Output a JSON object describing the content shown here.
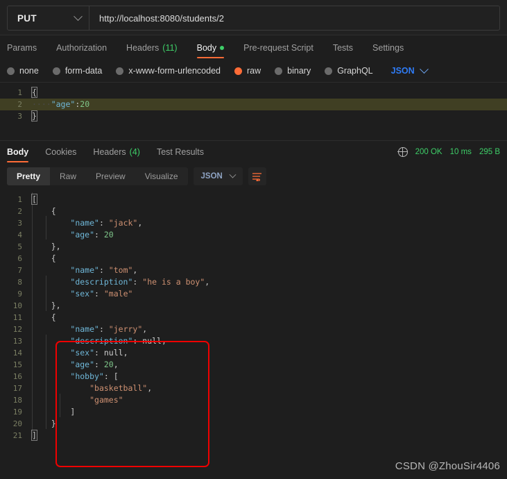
{
  "request": {
    "method": "PUT",
    "url": "http://localhost:8080/students/2",
    "tabs": [
      {
        "label": "Params",
        "count": "",
        "active": false,
        "dot": false
      },
      {
        "label": "Authorization",
        "count": "",
        "active": false,
        "dot": false
      },
      {
        "label": "Headers",
        "count": "(11)",
        "active": false,
        "dot": false
      },
      {
        "label": "Body",
        "count": "",
        "active": true,
        "dot": true
      },
      {
        "label": "Pre-request Script",
        "count": "",
        "active": false,
        "dot": false
      },
      {
        "label": "Tests",
        "count": "",
        "active": false,
        "dot": false
      },
      {
        "label": "Settings",
        "count": "",
        "active": false,
        "dot": false
      }
    ],
    "body_types": [
      {
        "label": "none",
        "selected": false
      },
      {
        "label": "form-data",
        "selected": false
      },
      {
        "label": "x-www-form-urlencoded",
        "selected": false
      },
      {
        "label": "raw",
        "selected": true
      },
      {
        "label": "binary",
        "selected": false
      },
      {
        "label": "GraphQL",
        "selected": false
      }
    ],
    "format": "JSON",
    "body_lines": [
      {
        "num": "1",
        "text": "{",
        "highlight": false
      },
      {
        "num": "2",
        "text": "    \"age\":20",
        "highlight": true
      },
      {
        "num": "3",
        "text": "}",
        "highlight": false
      }
    ]
  },
  "response": {
    "tabs": [
      {
        "label": "Body",
        "count": "",
        "active": true
      },
      {
        "label": "Cookies",
        "count": "",
        "active": false
      },
      {
        "label": "Headers",
        "count": "(4)",
        "active": false
      },
      {
        "label": "Test Results",
        "count": "",
        "active": false
      }
    ],
    "status": "200 OK",
    "time": "10 ms",
    "size": "295 B",
    "views": [
      {
        "label": "Pretty",
        "active": true
      },
      {
        "label": "Raw",
        "active": false
      },
      {
        "label": "Preview",
        "active": false
      },
      {
        "label": "Visualize",
        "active": false
      }
    ],
    "format": "JSON",
    "body_lines": [
      {
        "num": "1",
        "text": "["
      },
      {
        "num": "2",
        "text": "    {"
      },
      {
        "num": "3",
        "text": "        \"name\": \"jack\","
      },
      {
        "num": "4",
        "text": "        \"age\": 20"
      },
      {
        "num": "5",
        "text": "    },"
      },
      {
        "num": "6",
        "text": "    {"
      },
      {
        "num": "7",
        "text": "        \"name\": \"tom\","
      },
      {
        "num": "8",
        "text": "        \"description\": \"he is a boy\","
      },
      {
        "num": "9",
        "text": "        \"sex\": \"male\""
      },
      {
        "num": "10",
        "text": "    },"
      },
      {
        "num": "11",
        "text": "    {"
      },
      {
        "num": "12",
        "text": "        \"name\": \"jerry\","
      },
      {
        "num": "13",
        "text": "        \"description\": null,"
      },
      {
        "num": "14",
        "text": "        \"sex\": null,"
      },
      {
        "num": "15",
        "text": "        \"age\": 20,"
      },
      {
        "num": "16",
        "text": "        \"hobby\": ["
      },
      {
        "num": "17",
        "text": "            \"basketball\","
      },
      {
        "num": "18",
        "text": "            \"games\""
      },
      {
        "num": "19",
        "text": "        ]"
      },
      {
        "num": "20",
        "text": "    }"
      },
      {
        "num": "21",
        "text": "]"
      }
    ]
  },
  "watermark": "CSDN @ZhouSir4406",
  "colors": {
    "accent": "#ff6c37",
    "success": "#3ecf68",
    "link": "#2f7cf6",
    "annotation": "#f00000",
    "background": "#1e1e1e"
  }
}
